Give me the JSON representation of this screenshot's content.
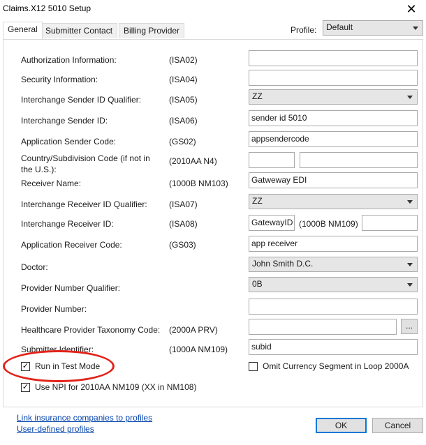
{
  "window": {
    "title": "Claims.X12 5010 Setup",
    "close_glyph": "✕"
  },
  "tabs": [
    "General",
    "Submitter Contact",
    "Billing Provider"
  ],
  "profile": {
    "label": "Profile:",
    "value": "Default"
  },
  "rows": [
    {
      "label": "Authorization Information:",
      "code": "(ISA02)",
      "value": ""
    },
    {
      "label": "Security Information:",
      "code": "(ISA04)",
      "value": ""
    },
    {
      "label": "Interchange Sender ID Qualifier:",
      "code": "(ISA05)",
      "value": "ZZ"
    },
    {
      "label": "Interchange Sender ID:",
      "code": "(ISA06)",
      "value": "sender id 5010"
    },
    {
      "label": "Application Sender Code:",
      "code": "(GS02)",
      "value": "appsendercode"
    },
    {
      "label_line1": "Country/Subdivision Code (if not in",
      "label_line2": "the U.S.):",
      "code": "(2010AA N4)",
      "value1": "",
      "value2": ""
    },
    {
      "label": "Receiver Name:",
      "code": "(1000B NM103)",
      "value": "Gatweway EDI"
    },
    {
      "label": "Interchange Receiver ID Qualifier:",
      "code": "(ISA07)",
      "value": "ZZ"
    },
    {
      "label": "Interchange Receiver ID:",
      "code": "(ISA08)",
      "value": "GatewayID",
      "extra_code": "(1000B NM109)",
      "extra_value": ""
    },
    {
      "label": "Application Receiver Code:",
      "code": "(GS03)",
      "value": "app receiver"
    },
    {
      "label": "Doctor:",
      "code": "",
      "value": "John Smith D.C."
    },
    {
      "label": "Provider Number Qualifier:",
      "code": "",
      "value": "0B"
    },
    {
      "label": "Provider Number:",
      "code": "",
      "value": ""
    },
    {
      "label": "Healthcare Provider Taxonomy Code:",
      "code": "(2000A PRV)",
      "value": "",
      "button": "..."
    },
    {
      "label": "Submitter Identifier:",
      "code": "(1000A NM109)",
      "value": "subid"
    }
  ],
  "checks": {
    "test_mode": {
      "label": "Run in Test Mode",
      "checked": true
    },
    "omit_currency": {
      "label": "Omit Currency Segment in Loop 2000A",
      "checked": false
    },
    "use_npi": {
      "label": "Use NPI for 2010AA NM109 (XX in NM108)",
      "checked": true
    }
  },
  "check_glyph": "✓",
  "links": {
    "insurance": "Link insurance companies to profiles",
    "user_profiles": "User-defined profiles"
  },
  "buttons": {
    "ok": "OK",
    "cancel": "Cancel"
  },
  "colors": {
    "highlight_oval": "#e2231a",
    "link": "#0645ad",
    "ok_border": "#0078d7"
  }
}
